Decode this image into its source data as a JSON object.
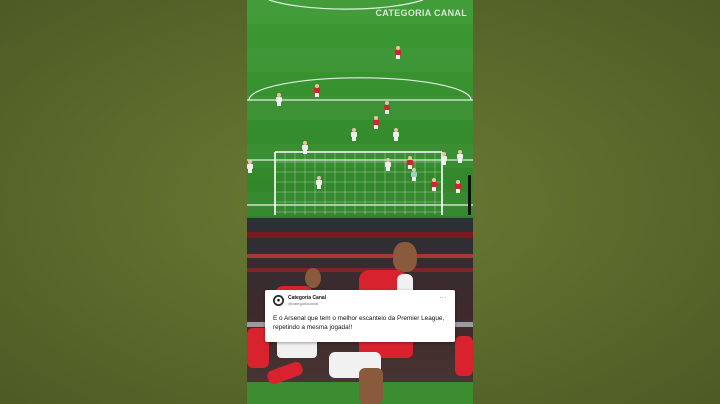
{
  "video": {
    "watermark": "CATEGORIA CANAL"
  },
  "tweet": {
    "author_name": "Categoria Canal",
    "author_handle": "@categoriacanal",
    "avatar_icon": "soccer-ball-icon",
    "more_icon": "more-dots-icon",
    "more_glyph": "···",
    "text": "E o Arsenal que tem o melhor escanteio da Premier League, repetindo a mesma jogada!!"
  },
  "colors": {
    "background": "#5a6a2b",
    "pitch": "#368f2e",
    "arsenal_red": "#d2242f",
    "opponent_white": "#eeeeee",
    "tweet_card": "#ffffff"
  }
}
